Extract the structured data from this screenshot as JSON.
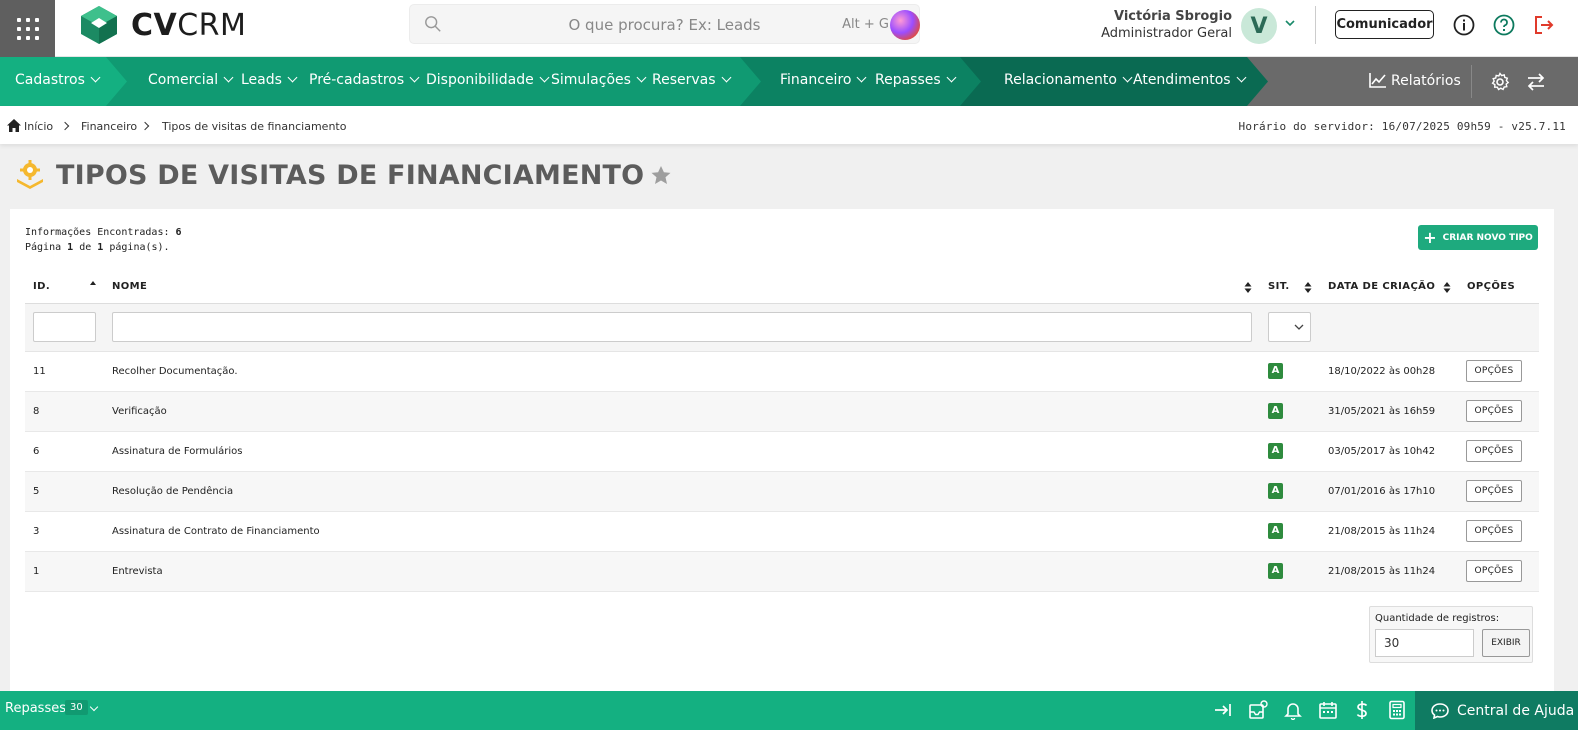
{
  "header": {
    "brand": "CVCRM",
    "search_placeholder": "O que procura? Ex: Leads",
    "search_shortcut": "Alt + G",
    "user_name": "Victória Sbrogio",
    "user_role": "Administrador Geral",
    "avatar_initial": "V",
    "communicator_label": "Comunicador"
  },
  "nav": {
    "cadastros": "Cadastros",
    "comercial": "Comercial",
    "leads": "Leads",
    "pre_cadastros": "Pré-cadastros",
    "disponibilidade": "Disponibilidade",
    "simulacoes": "Simulações",
    "reservas": "Reservas",
    "financeiro": "Financeiro",
    "repasses": "Repasses",
    "relacionamento": "Relacionamento",
    "atendimentos": "Atendimentos",
    "relatorios": "Relatórios",
    "colors": {
      "green1": "#14b081",
      "green2": "#109a72",
      "green3": "#0c8262",
      "green4": "#0a6a52",
      "gray": "#6a6a6a"
    }
  },
  "breadcrumb": {
    "home": "Início",
    "level1": "Financeiro",
    "level2": "Tipos de visitas de financiamento",
    "server_time": "Horário do servidor: 16/07/2025 09h59 - v25.7.11"
  },
  "page": {
    "title": "TIPOS DE VISITAS DE FINANCIAMENTO",
    "info_found_label": "Informações Encontradas:",
    "info_found_value": "6",
    "page_prefix": "Página",
    "page_current": "1",
    "page_of": "de",
    "page_total": "1",
    "page_suffix": "página(s).",
    "create_button": "CRIAR NOVO TIPO"
  },
  "table": {
    "headers": {
      "id": "ID.",
      "name": "NOME",
      "sit": "SIT.",
      "created": "DATA DE CRIAÇÃO",
      "options": "OPÇÕES"
    },
    "rows": [
      {
        "id": "11",
        "name": "Recolher Documentação.",
        "sit": "A",
        "created": "18/10/2022 às 00h28",
        "options": "OPÇÕES"
      },
      {
        "id": "8",
        "name": "Verificação",
        "sit": "A",
        "created": "31/05/2021 às 16h59",
        "options": "OPÇÕES"
      },
      {
        "id": "6",
        "name": "Assinatura de Formulários",
        "sit": "A",
        "created": "03/05/2017 às 10h42",
        "options": "OPÇÕES"
      },
      {
        "id": "5",
        "name": "Resolução de Pendência",
        "sit": "A",
        "created": "07/01/2016 às 17h10",
        "options": "OPÇÕES"
      },
      {
        "id": "3",
        "name": "Assinatura de Contrato de Financiamento",
        "sit": "A",
        "created": "21/08/2015 às 11h24",
        "options": "OPÇÕES"
      },
      {
        "id": "1",
        "name": "Entrevista",
        "sit": "A",
        "created": "21/08/2015 às 11h24",
        "options": "OPÇÕES"
      }
    ]
  },
  "pagination": {
    "qty_label": "Quantidade de registros:",
    "qty_value": "30",
    "show_button": "EXIBIR"
  },
  "footer": {
    "repasses_label": "Repasses",
    "repasses_count": "30",
    "help_label": "Central de Ajuda"
  },
  "icons": [
    "apps-grid-icon",
    "search-icon",
    "chevron-down-icon",
    "info-icon",
    "help-icon",
    "logout-icon",
    "chart-icon",
    "gear-icon",
    "swap-icon",
    "home-icon",
    "gear-badge-icon",
    "star-icon",
    "plus-icon",
    "sort-icon",
    "arrow-to-right-icon",
    "inbox-icon",
    "bell-icon",
    "calendar-icon",
    "dollar-icon",
    "calculator-icon",
    "chat-icon"
  ]
}
